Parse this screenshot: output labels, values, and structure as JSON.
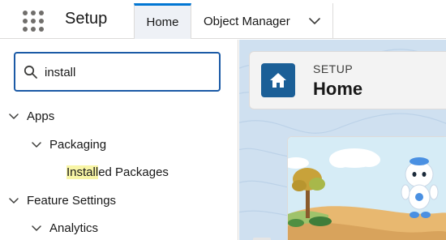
{
  "header": {
    "app_title": "Setup",
    "tabs": [
      {
        "label": "Home",
        "active": true
      },
      {
        "label": "Object Manager",
        "has_dropdown": true
      }
    ]
  },
  "sidebar": {
    "quick_find": {
      "value": "install"
    },
    "tree": {
      "apps": {
        "label": "Apps",
        "children": {
          "packaging": {
            "label": "Packaging",
            "children": {
              "installed_packages": {
                "label_match": "Install",
                "label_rest": "ed Packages"
              }
            }
          }
        }
      },
      "feature_settings": {
        "label": "Feature Settings",
        "children": {
          "analytics": {
            "label": "Analytics"
          }
        }
      }
    }
  },
  "main": {
    "page_header": {
      "eyebrow": "SETUP",
      "title": "Home",
      "icon": "home-icon"
    }
  },
  "colors": {
    "accent": "#0176d3",
    "icon_box": "#1b5f97",
    "search_border": "#1b5aa6",
    "highlight": "#f8f5a6",
    "main_background": "#cfe0f0"
  }
}
